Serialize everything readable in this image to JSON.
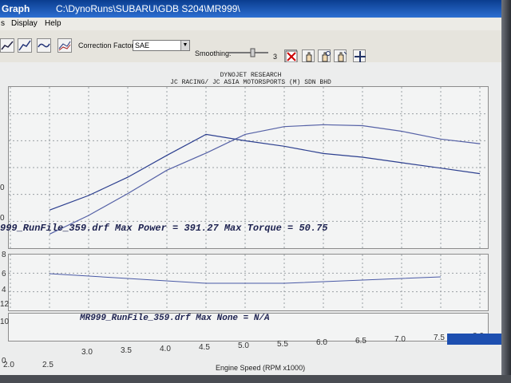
{
  "window": {
    "title_left": "Graph",
    "title_path": "C:\\DynoRuns\\SUBARU\\GDB S204\\MR999\\"
  },
  "menu": [
    "s",
    "Display",
    "Help"
  ],
  "toolbar": {
    "correction_label": "Correction Factor:",
    "correction_value": "SAE",
    "smoothing_label": "Smoothing:",
    "smoothing_value": "3"
  },
  "graph": {
    "header1": "DYNOJET RESEARCH",
    "header2": "JC RACING/ JC ASIA MOTORSPORTS (M) SDN BHD",
    "run_label_top": "999_RunFile_359.drf Max Power = 391.27  Max Torque = 50.75",
    "run_label_bottom": "MR999_RunFile_359.drf Max None = N/A",
    "x_axis_label": "Engine Speed (RPM x1000)",
    "x_ticks": [
      "2.0",
      "2.5",
      "3.0",
      "3.5",
      "4.0",
      "4.5",
      "5.0",
      "5.5",
      "6.0",
      "6.5",
      "7.0",
      "7.5",
      "8.0"
    ],
    "y_left_top": [
      "0",
      "0",
      "0"
    ],
    "y_left_mid": [
      "8",
      "6",
      "4",
      "12",
      "10"
    ],
    "y_left_bottom": [
      "0"
    ]
  },
  "taskbar": {
    "text": ""
  },
  "chart_data": {
    "type": "line",
    "title": "DYNOJET RESEARCH",
    "xlabel": "Engine Speed (RPM x1000)",
    "x": [
      2.5,
      3.0,
      3.5,
      4.0,
      4.5,
      5.0,
      5.5,
      6.0,
      6.5,
      7.0,
      7.5,
      8.0
    ],
    "series": [
      {
        "name": "",
        "values": [
          40,
          100,
          170,
          245,
          300,
          360,
          385,
          391,
          388,
          370,
          345,
          330
        ]
      },
      {
        "name": "",
        "values": [
          30,
          34,
          39,
          45,
          50.75,
          49,
          47.5,
          45.5,
          44.5,
          43,
          41.5,
          40
        ]
      }
    ],
    "xlim": [
      2.0,
      8.0
    ]
  }
}
